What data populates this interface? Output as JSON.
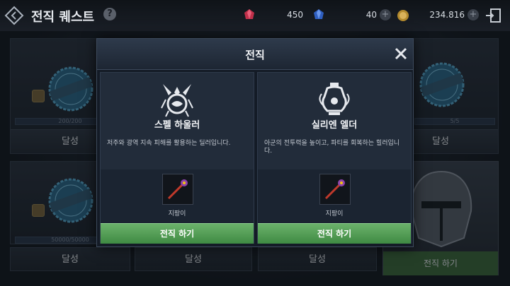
{
  "header": {
    "title": "전직 퀘스트",
    "help_icon": "?",
    "currencies": [
      {
        "icon": "red-gem-icon",
        "value": "450"
      },
      {
        "icon": "blue-gem-icon",
        "value": "40"
      },
      {
        "icon": "gold-coin-icon",
        "value": "234.816"
      }
    ]
  },
  "background": {
    "cards": [
      {
        "progress": "200/200",
        "achieve": "달성"
      },
      {
        "progress": "5/5",
        "achieve": "달성"
      },
      {
        "progress": "50000/50000"
      }
    ],
    "stamp_text": "COMPLETE",
    "bottom_buttons": [
      "달성",
      "달성",
      "달성",
      "달성"
    ],
    "helm_button": "전직 하기"
  },
  "modal": {
    "title": "전직",
    "options": [
      {
        "emblem": "spell-howler-emblem-icon",
        "name": "스펠 하울러",
        "description": "저주와 광역 지속 피해를 활용하는 딜러입니다.",
        "weapon": "지팡이",
        "button": "전직 하기"
      },
      {
        "emblem": "silien-elder-emblem-icon",
        "name": "실리엔 엘더",
        "description": "아군의 전투력을 높이고, 파티를 회복하는 힐러입니다.",
        "weapon": "지팡이",
        "button": "전직 하기"
      }
    ]
  },
  "colors": {
    "accent_green": "#4f9a52",
    "panel": "#1b2431",
    "gold": "#c8a14a"
  }
}
